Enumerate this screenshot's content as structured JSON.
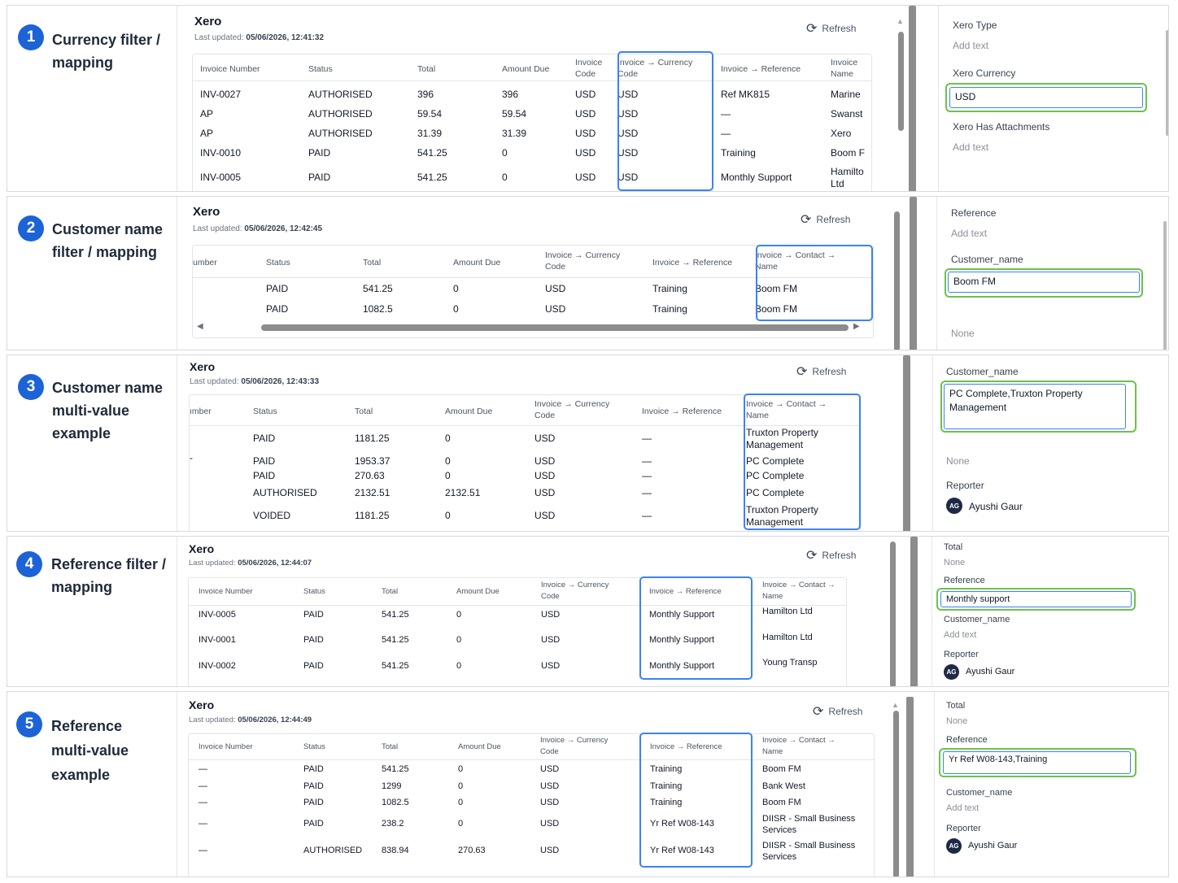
{
  "refresh_label": "Refresh",
  "updated_label": "Last updated:",
  "panels": [
    {
      "step": "1",
      "title": [
        "Currency filter /",
        "mapping"
      ],
      "app": "Xero",
      "updated": "05/06/2026, 12:41:32",
      "headers": [
        [
          "Invoice Number"
        ],
        [
          "Status"
        ],
        [
          "Total"
        ],
        [
          "Amount Due"
        ],
        [
          "Invoice",
          "Code"
        ],
        [
          "Invoice → Currency",
          "Code"
        ],
        [
          "Invoice → Reference"
        ],
        [
          "Invoice",
          "Name"
        ]
      ],
      "rows": [
        [
          "INV-0027",
          "AUTHORISED",
          "396",
          "396",
          "USD",
          "USD",
          "Ref MK815",
          "Marine"
        ],
        [
          "AP",
          "AUTHORISED",
          "59.54",
          "59.54",
          "USD",
          "USD",
          "—",
          "Swanst"
        ],
        [
          "AP",
          "AUTHORISED",
          "31.39",
          "31.39",
          "USD",
          "USD",
          "—",
          "Xero"
        ],
        [
          "INV-0010",
          "PAID",
          "541.25",
          "0",
          "USD",
          "USD",
          "Training",
          "Boom F"
        ],
        [
          "INV-0005",
          "PAID",
          "541.25",
          "0",
          "USD",
          "USD",
          "Monthly Support",
          "Hamilto Ltd"
        ]
      ],
      "fields": [
        {
          "label": "Xero Type",
          "value": "Add text"
        },
        {
          "label": "Xero Currency",
          "input": "USD"
        },
        {
          "label": "Xero Has Attachments",
          "value": "Add text"
        }
      ]
    },
    {
      "step": "2",
      "title": [
        "Customer name",
        "filter / mapping"
      ],
      "app": "Xero",
      "updated": "05/06/2026, 12:42:45",
      "headers": [
        [
          "umber"
        ],
        [
          "Status"
        ],
        [
          "Total"
        ],
        [
          "Amount Due"
        ],
        [
          "Invoice → Currency",
          "Code"
        ],
        [
          "Invoice → Reference"
        ],
        [
          "Invoice → Contact →",
          "Name"
        ]
      ],
      "rows": [
        [
          "",
          "PAID",
          "541.25",
          "0",
          "USD",
          "Training",
          "Boom FM"
        ],
        [
          "",
          "PAID",
          "1082.5",
          "0",
          "USD",
          "Training",
          "Boom FM"
        ]
      ],
      "fields": [
        {
          "label": "Reference",
          "value": "Add text"
        },
        {
          "label": "Customer_name",
          "input": "Boom FM"
        },
        {
          "value": "None"
        }
      ]
    },
    {
      "step": "3",
      "title": [
        "Customer name",
        "multi-value",
        "example"
      ],
      "app": "Xero",
      "updated": "05/06/2026, 12:43:33",
      "headers": [
        [
          "ımber"
        ],
        [
          "Status"
        ],
        [
          "Total"
        ],
        [
          "Amount Due"
        ],
        [
          "Invoice → Currency",
          "Code"
        ],
        [
          "Invoice → Reference"
        ],
        [
          "Invoice → Contact →",
          "Name"
        ]
      ],
      "rows": [
        [
          "",
          "PAID",
          "1181.25",
          "0",
          "USD",
          "—",
          "Truxton Property Management"
        ],
        [
          "-",
          "PAID",
          "1953.37",
          "0",
          "USD",
          "—",
          "PC Complete"
        ],
        [
          "",
          "PAID",
          "270.63",
          "0",
          "USD",
          "—",
          "PC Complete"
        ],
        [
          "",
          "AUTHORISED",
          "2132.51",
          "2132.51",
          "USD",
          "—",
          "PC Complete"
        ],
        [
          "",
          "VOIDED",
          "1181.25",
          "0",
          "USD",
          "—",
          "Truxton Property Management"
        ]
      ],
      "fields": [
        {
          "label": "Customer_name",
          "input": "PC Complete,Truxton Property Management"
        },
        {
          "value": "None"
        },
        {
          "label": "Reporter",
          "user": "Ayushi Gaur",
          "initials": "AG"
        }
      ]
    },
    {
      "step": "4",
      "title": [
        "Reference filter /",
        "mapping"
      ],
      "app": "Xero",
      "updated": "05/06/2026, 12:44:07",
      "headers": [
        [
          "Invoice Number"
        ],
        [
          "Status"
        ],
        [
          "Total"
        ],
        [
          "Amount Due"
        ],
        [
          "Invoice → Currency",
          "Code"
        ],
        [
          "Invoice → Reference"
        ],
        [
          "Invoice → Contact →",
          "Name"
        ]
      ],
      "rows": [
        [
          "INV-0005",
          "PAID",
          "541.25",
          "0",
          "USD",
          "Monthly Support",
          "Hamilton Ltd"
        ],
        [
          "INV-0001",
          "PAID",
          "541.25",
          "0",
          "USD",
          "Monthly Support",
          "Hamilton Ltd"
        ],
        [
          "INV-0002",
          "PAID",
          "541.25",
          "0",
          "USD",
          "Monthly Support",
          "Young Transp"
        ]
      ],
      "fields": [
        {
          "label": "Total",
          "value": "None"
        },
        {
          "label": "Reference",
          "input": "Monthly support"
        },
        {
          "label": "Customer_name",
          "value": "Add text"
        },
        {
          "label": "Reporter",
          "user": "Ayushi Gaur",
          "initials": "AG"
        }
      ]
    },
    {
      "step": "5",
      "title": [
        "Reference",
        "multi-value",
        "example"
      ],
      "app": "Xero",
      "updated": "05/06/2026, 12:44:49",
      "headers": [
        [
          "Invoice Number"
        ],
        [
          "Status"
        ],
        [
          "Total"
        ],
        [
          "Amount Due"
        ],
        [
          "Invoice → Currency",
          "Code"
        ],
        [
          "Invoice → Reference"
        ],
        [
          "Invoice → Contact →",
          "Name"
        ]
      ],
      "rows": [
        [
          "—",
          "PAID",
          "541.25",
          "0",
          "USD",
          "Training",
          "Boom FM"
        ],
        [
          "—",
          "PAID",
          "1299",
          "0",
          "USD",
          "Training",
          "Bank West"
        ],
        [
          "—",
          "PAID",
          "1082.5",
          "0",
          "USD",
          "Training",
          "Boom FM"
        ],
        [
          "—",
          "PAID",
          "238.2",
          "0",
          "USD",
          "Yr Ref W08-143",
          "DIISR - Small Business Services"
        ],
        [
          "—",
          "AUTHORISED",
          "838.94",
          "270.63",
          "USD",
          "Yr Ref W08-143",
          "DIISR - Small Business Services"
        ]
      ],
      "fields": [
        {
          "label": "Total",
          "value": "None"
        },
        {
          "label": "Reference",
          "input": "Yr Ref W08-143,Training"
        },
        {
          "label": "Customer_name",
          "value": "Add text"
        },
        {
          "label": "Reporter",
          "user": "Ayushi Gaur",
          "initials": "AG"
        }
      ]
    }
  ],
  "colors": {
    "step_badge": "#1d63d8",
    "table_highlight": "#3b82f6",
    "field_highlight": "#6cc24a"
  },
  "icons": [
    "refresh-icon"
  ]
}
